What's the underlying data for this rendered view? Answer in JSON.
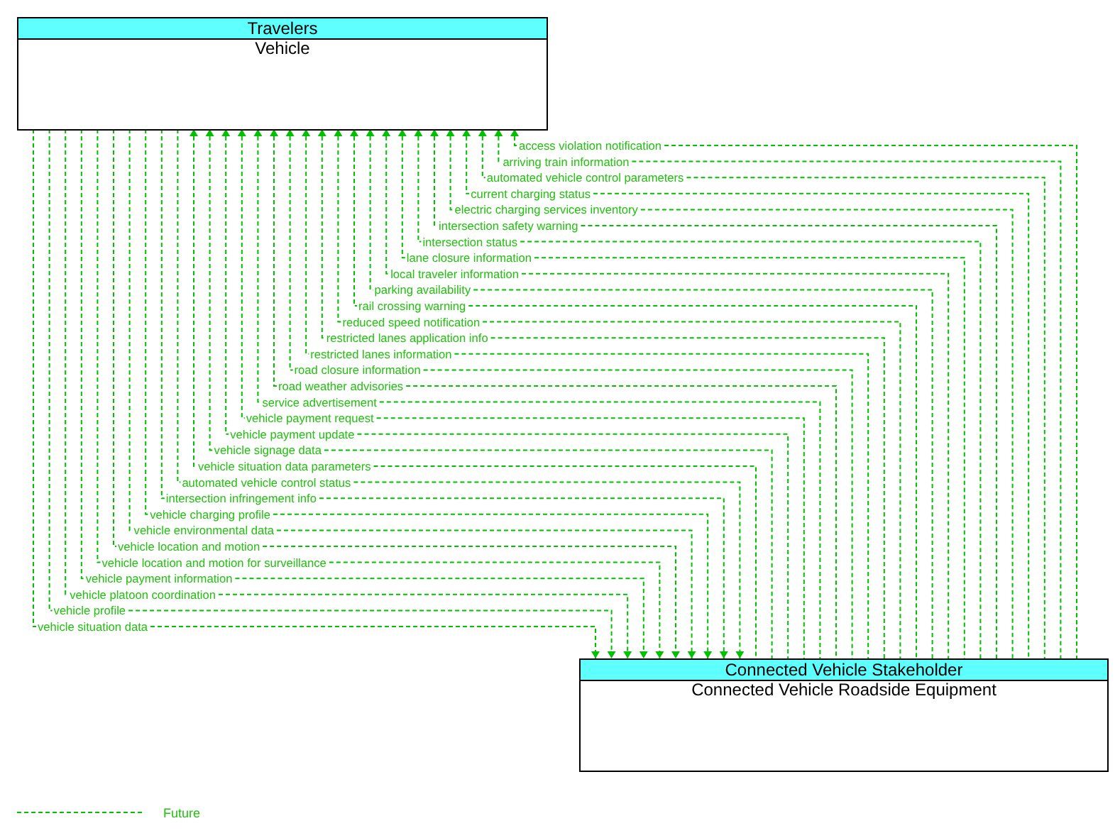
{
  "travelers_box": {
    "header": "Travelers",
    "name": "Vehicle"
  },
  "equipment_box": {
    "header": "Connected Vehicle Stakeholder",
    "name": "Connected Vehicle Roadside Equipment"
  },
  "flows_to_vehicle": [
    {
      "label": "access violation notification"
    },
    {
      "label": "arriving train information"
    },
    {
      "label": "automated vehicle control parameters"
    },
    {
      "label": "current charging status"
    },
    {
      "label": "electric charging services inventory"
    },
    {
      "label": "intersection safety warning"
    },
    {
      "label": "intersection status"
    },
    {
      "label": "lane closure information"
    },
    {
      "label": "local traveler information"
    },
    {
      "label": "parking availability"
    },
    {
      "label": "rail crossing warning"
    },
    {
      "label": "reduced speed notification"
    },
    {
      "label": "restricted lanes application info"
    },
    {
      "label": "restricted lanes information"
    },
    {
      "label": "road closure information"
    },
    {
      "label": "road weather advisories"
    },
    {
      "label": "service advertisement"
    },
    {
      "label": "vehicle payment request"
    },
    {
      "label": "vehicle payment update"
    },
    {
      "label": "vehicle signage data"
    },
    {
      "label": "vehicle situation data parameters"
    }
  ],
  "flows_to_equipment": [
    {
      "label": "automated vehicle control status"
    },
    {
      "label": "intersection infringement info"
    },
    {
      "label": "vehicle charging profile"
    },
    {
      "label": "vehicle environmental data"
    },
    {
      "label": "vehicle location and motion"
    },
    {
      "label": "vehicle location and motion for surveillance"
    },
    {
      "label": "vehicle payment information"
    },
    {
      "label": "vehicle platoon coordination"
    },
    {
      "label": "vehicle profile"
    },
    {
      "label": "vehicle situation data"
    }
  ],
  "legend": [
    {
      "label": "Future"
    }
  ]
}
